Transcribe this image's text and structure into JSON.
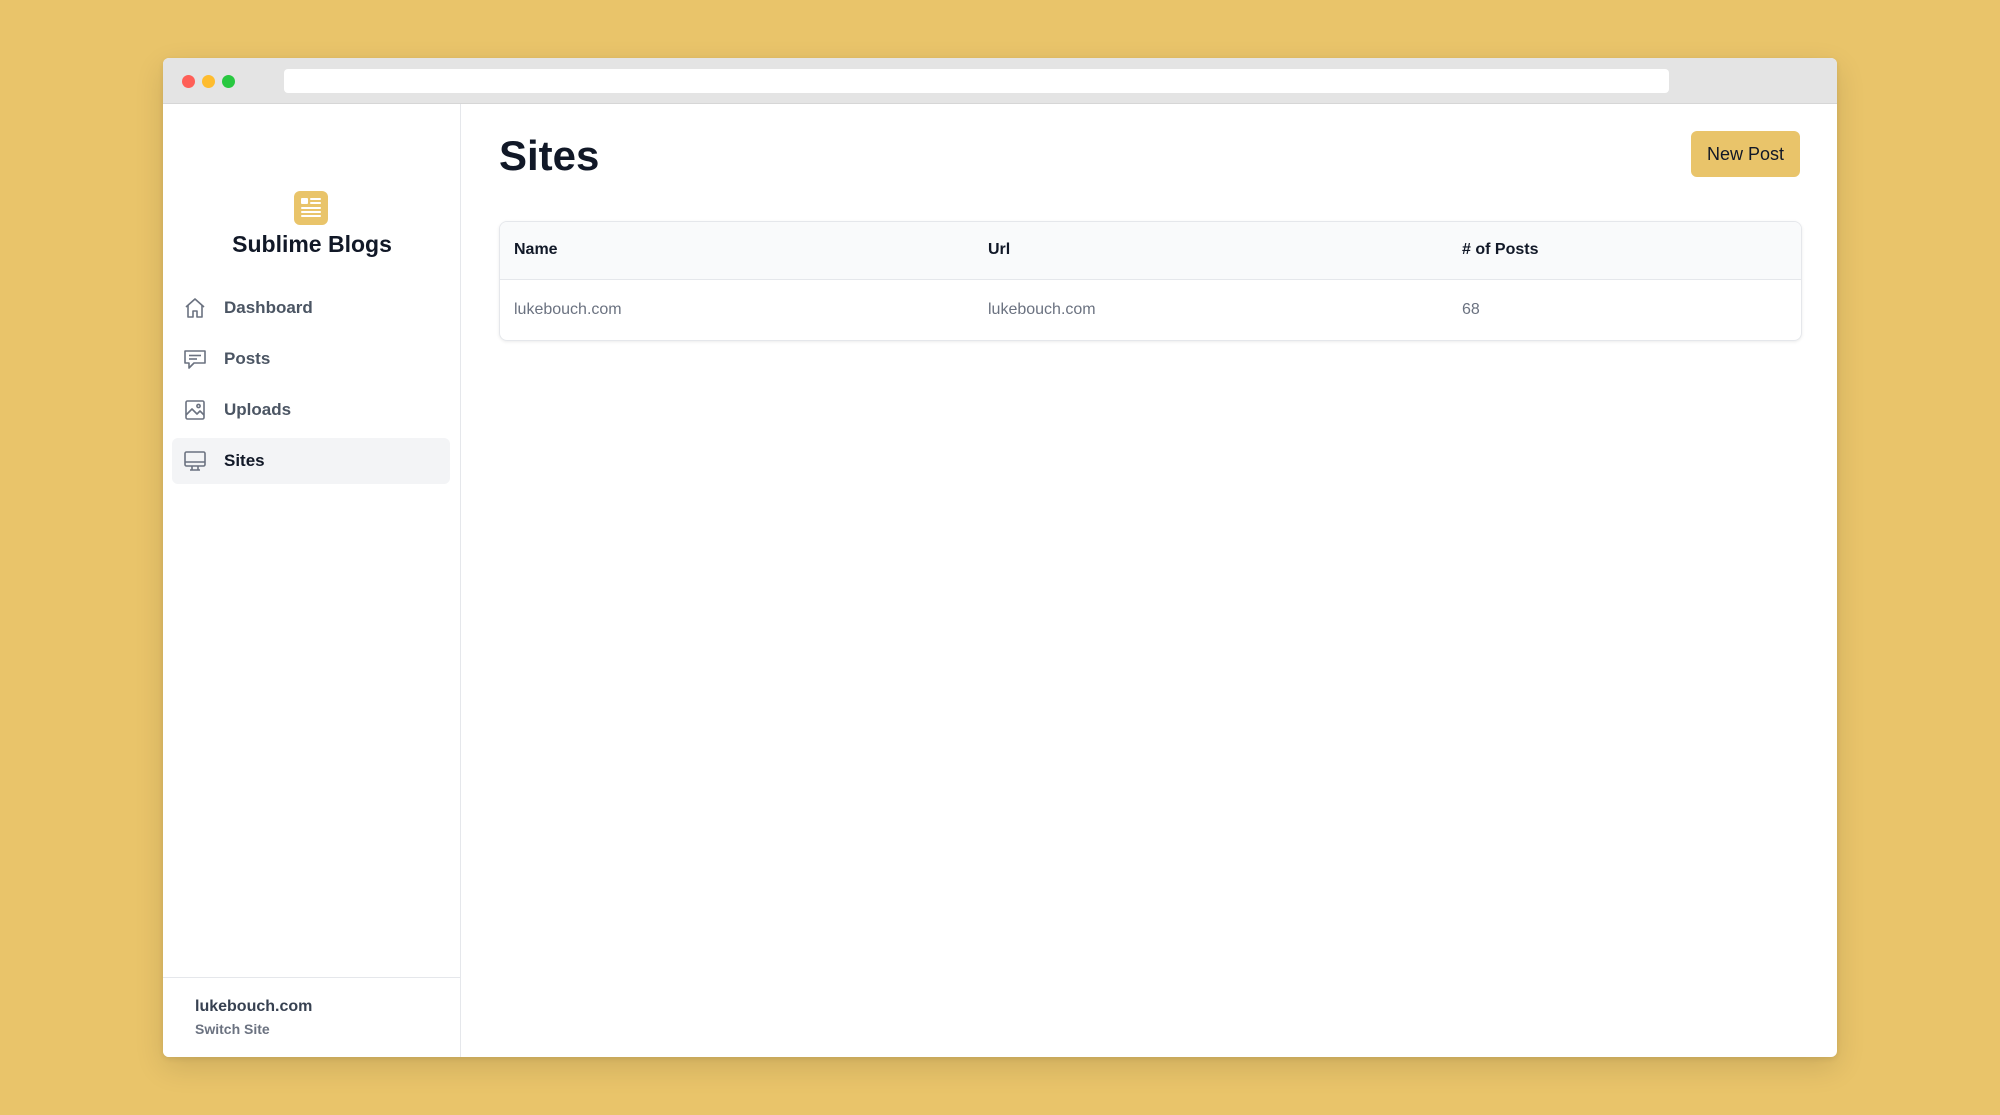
{
  "app": {
    "brand": "Sublime Blogs",
    "accent_color": "#E9C46A",
    "background_color": "#E9C46A"
  },
  "browser": {
    "address_value": ""
  },
  "sidebar": {
    "items": [
      {
        "label": "Dashboard",
        "icon": "home-icon",
        "active": false
      },
      {
        "label": "Posts",
        "icon": "chat-bubble-icon",
        "active": false
      },
      {
        "label": "Uploads",
        "icon": "image-icon",
        "active": false
      },
      {
        "label": "Sites",
        "icon": "monitor-icon",
        "active": true
      }
    ],
    "footer": {
      "site_name": "lukebouch.com",
      "switch_label": "Switch Site"
    }
  },
  "main": {
    "title": "Sites",
    "new_post_label": "New Post",
    "table": {
      "headers": [
        "Name",
        "Url",
        "# of Posts"
      ],
      "rows": [
        [
          "lukebouch.com",
          "lukebouch.com",
          "68"
        ]
      ]
    }
  }
}
